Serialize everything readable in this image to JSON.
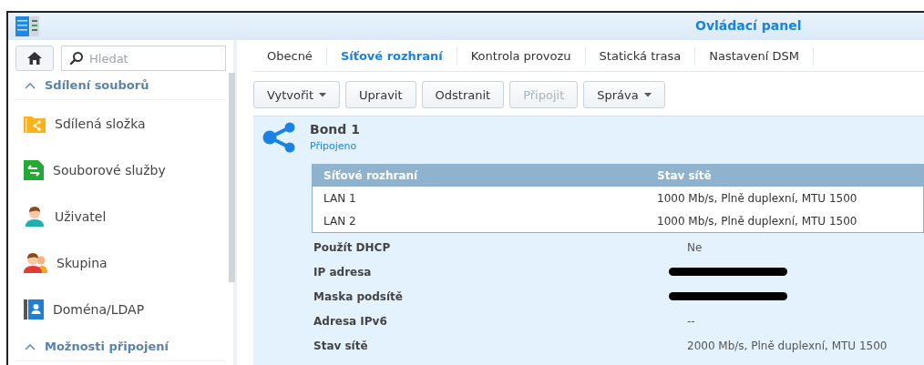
{
  "window": {
    "title": "Ovládací panel"
  },
  "search": {
    "placeholder": "Hledat"
  },
  "sidebar": {
    "sections": [
      {
        "label": "Sdílení souborů",
        "expanded": true,
        "items": [
          {
            "label": "Sdílená složka",
            "selected": false
          },
          {
            "label": "Souborové služby",
            "selected": false
          },
          {
            "label": "Uživatel",
            "selected": false
          },
          {
            "label": "Skupina",
            "selected": false
          },
          {
            "label": "Doména/LDAP",
            "selected": false
          }
        ]
      },
      {
        "label": "Možnosti připojení",
        "expanded": true
      }
    ]
  },
  "tabs": [
    {
      "label": "Obecné",
      "selected": false
    },
    {
      "label": "Síťové rozhraní",
      "selected": true
    },
    {
      "label": "Kontrola provozu",
      "selected": false
    },
    {
      "label": "Statická trasa",
      "selected": false
    },
    {
      "label": "Nastavení DSM",
      "selected": false
    }
  ],
  "toolbar": [
    {
      "label": "Vytvořit",
      "menu": true,
      "disabled": false
    },
    {
      "label": "Upravit",
      "menu": false,
      "disabled": false
    },
    {
      "label": "Odstranit",
      "menu": false,
      "disabled": false
    },
    {
      "label": "Připojit",
      "menu": false,
      "disabled": true
    },
    {
      "label": "Správa",
      "menu": true,
      "disabled": false
    }
  ],
  "interface": {
    "name": "Bond 1",
    "status": "Připojeno",
    "table": {
      "columns": [
        "Síťové rozhraní",
        "Stav sítě"
      ],
      "rows": [
        [
          "LAN 1",
          "1000 Mb/s, Plně duplexní, MTU 1500"
        ],
        [
          "LAN 2",
          "1000 Mb/s, Plně duplexní, MTU 1500"
        ]
      ]
    },
    "properties": [
      {
        "label": "Použít DHCP",
        "value": "Ne",
        "redacted": false
      },
      {
        "label": "IP adresa",
        "redacted": true
      },
      {
        "label": "Maska podsítě",
        "redacted": true
      },
      {
        "label": "Adresa IPv6",
        "value": "--",
        "redacted": false
      },
      {
        "label": "Stav sítě",
        "value": "2000 Mb/s, Plně duplexní, MTU 1500",
        "redacted": false
      }
    ]
  }
}
